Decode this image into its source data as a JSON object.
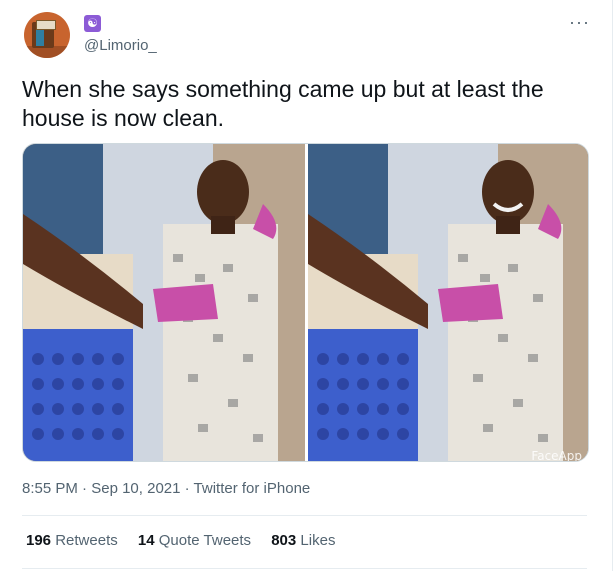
{
  "user": {
    "handle": "@Limorio_",
    "badge_glyph": "☯",
    "badge_color": "#8c5bd6",
    "avatar_icon": "house-door-avatar"
  },
  "menu": {
    "more_glyph": "···"
  },
  "tweet": {
    "text": "When she says something came up but at least the house is now clean."
  },
  "media": {
    "watermark": "FaceApp",
    "panels": [
      "original-photo",
      "faceapp-smile-photo"
    ]
  },
  "meta": {
    "time": "8:55 PM",
    "separator": "·",
    "date": "Sep 10, 2021",
    "source": "Twitter for iPhone"
  },
  "stats": {
    "retweets_count": "196",
    "retweets_label": "Retweets",
    "quotes_count": "14",
    "quotes_label": "Quote Tweets",
    "likes_count": "803",
    "likes_label": "Likes"
  },
  "colors": {
    "text": "#0f1419",
    "secondary": "#536471",
    "divider": "#e6ecf0"
  }
}
